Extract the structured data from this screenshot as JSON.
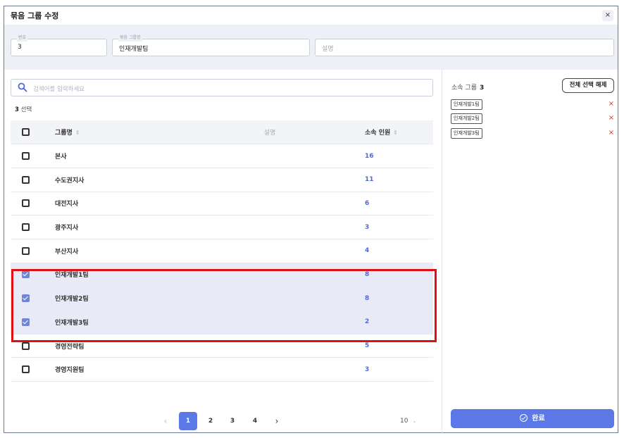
{
  "dialog": {
    "title": "묶음 그룹 수정",
    "close": "×"
  },
  "form": {
    "number": {
      "label": "번호",
      "value": "3"
    },
    "group_name": {
      "label": "묶음 그룹명",
      "value": "인재개발팀"
    },
    "description": {
      "placeholder": "설명"
    }
  },
  "search": {
    "placeholder": "검색어를 입력하세요"
  },
  "selection": {
    "count": "3",
    "suffix": "선택"
  },
  "table": {
    "headers": {
      "name": "그룹명",
      "description": "설명",
      "members": "소속 인원"
    },
    "rows": [
      {
        "name": "본사",
        "members": "16",
        "checked": false
      },
      {
        "name": "수도권지사",
        "members": "11",
        "checked": false
      },
      {
        "name": "대전지사",
        "members": "6",
        "checked": false
      },
      {
        "name": "광주지사",
        "members": "3",
        "checked": false
      },
      {
        "name": "부산지사",
        "members": "4",
        "checked": false
      },
      {
        "name": "인재개발1팀",
        "members": "8",
        "checked": true
      },
      {
        "name": "인재개발2팀",
        "members": "8",
        "checked": true
      },
      {
        "name": "인재개발3팀",
        "members": "2",
        "checked": true
      },
      {
        "name": "경영전략팀",
        "members": "5",
        "checked": false
      },
      {
        "name": "경영지원팀",
        "members": "3",
        "checked": false
      }
    ]
  },
  "pagination": {
    "prev": "‹",
    "next": "›",
    "pages": [
      "1",
      "2",
      "3",
      "4"
    ],
    "current": "1",
    "page_size": "10",
    "page_size_arrow": "⌄"
  },
  "right": {
    "title": "소속 그룹",
    "count": "3",
    "deselect_all": "전체 선택 해제",
    "tags": [
      "인재개발1팀",
      "인재개발2팀",
      "인재개발3팀"
    ],
    "remove": "×",
    "done": "완료"
  },
  "colors": {
    "accent": "#5b78e6",
    "highlight": "#e01010",
    "remove": "#e23030"
  }
}
